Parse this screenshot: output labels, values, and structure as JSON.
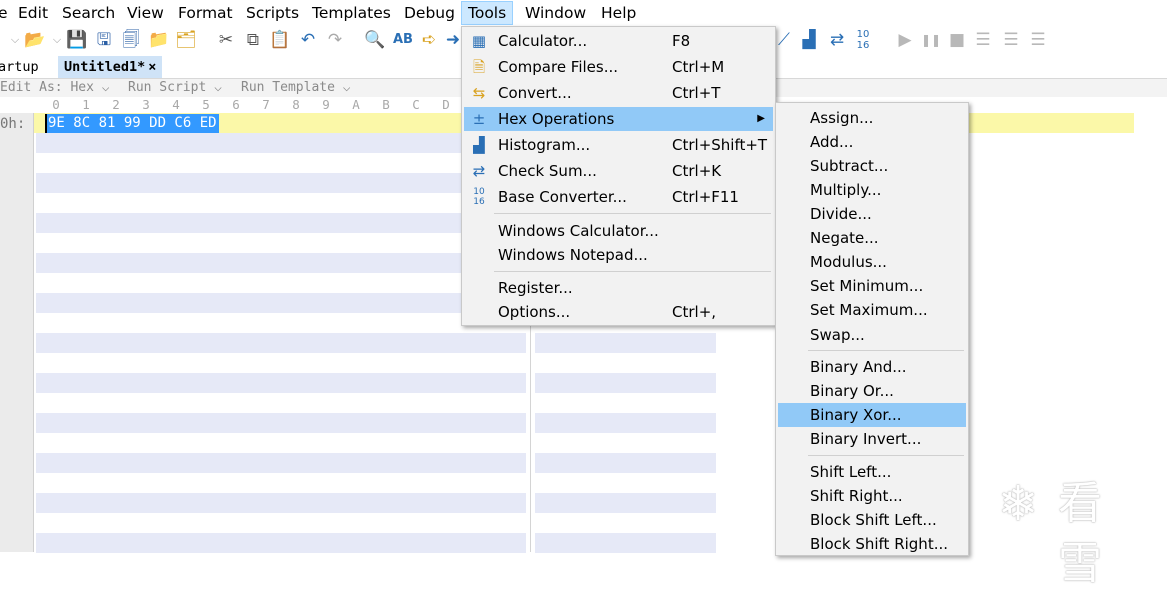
{
  "menubar": {
    "items": [
      "e",
      "Edit",
      "Search",
      "View",
      "Format",
      "Scripts",
      "Templates",
      "Debug",
      "Tools",
      "Window",
      "Help"
    ]
  },
  "tabs": {
    "startup": "artup",
    "active": "Untitled1*",
    "close": "×"
  },
  "editbar": {
    "edit_as": "Edit As: Hex",
    "run_script": "Run Script",
    "run_template": "Run Template",
    "chevron": "⌵"
  },
  "columns": [
    "0",
    "1",
    "2",
    "3",
    "4",
    "5",
    "6",
    "7",
    "8",
    "9",
    "A",
    "B",
    "C",
    "D"
  ],
  "hex": {
    "row_address": "0h:",
    "selected_bytes": "9E 8C 81 99 DD C6 ED"
  },
  "tools_menu": {
    "items": [
      {
        "label": "Calculator...",
        "shortcut": "F8",
        "icon": "calculator-icon"
      },
      {
        "label": "Compare Files...",
        "shortcut": "Ctrl+M",
        "icon": "compare-files-icon"
      },
      {
        "label": "Convert...",
        "shortcut": "Ctrl+T",
        "icon": "convert-icon"
      },
      {
        "label": "Hex Operations",
        "shortcut": "",
        "icon": "hex-operations-icon"
      },
      {
        "label": "Histogram...",
        "shortcut": "Ctrl+Shift+T",
        "icon": "histogram-icon"
      },
      {
        "label": "Check Sum...",
        "shortcut": "Ctrl+K",
        "icon": "checksum-icon"
      },
      {
        "label": "Base Converter...",
        "shortcut": "Ctrl+F11",
        "icon": "base-converter-icon"
      },
      {
        "label": "Windows Calculator...",
        "shortcut": ""
      },
      {
        "label": "Windows Notepad...",
        "shortcut": ""
      },
      {
        "label": "Register...",
        "shortcut": ""
      },
      {
        "label": "Options...",
        "shortcut": "Ctrl+,"
      }
    ],
    "submenu_arrow": "▶"
  },
  "hex_ops_menu": {
    "items": [
      "Assign...",
      "Add...",
      "Subtract...",
      "Multiply...",
      "Divide...",
      "Negate...",
      "Modulus...",
      "Set Minimum...",
      "Set Maximum...",
      "Swap...",
      "Binary And...",
      "Binary Or...",
      "Binary Xor...",
      "Binary Invert...",
      "Shift Left...",
      "Shift Right...",
      "Block Shift Left...",
      "Block Shift Right..."
    ],
    "highlighted": "Binary Xor..."
  },
  "watermark": {
    "icon": "snowflake-logo-icon",
    "text": "看雪"
  },
  "colors": {
    "menu_highlight": "#91c9f7",
    "selection": "#3399ff",
    "current_row": "#fbf8a8",
    "stripe": "#e6e9f7"
  }
}
